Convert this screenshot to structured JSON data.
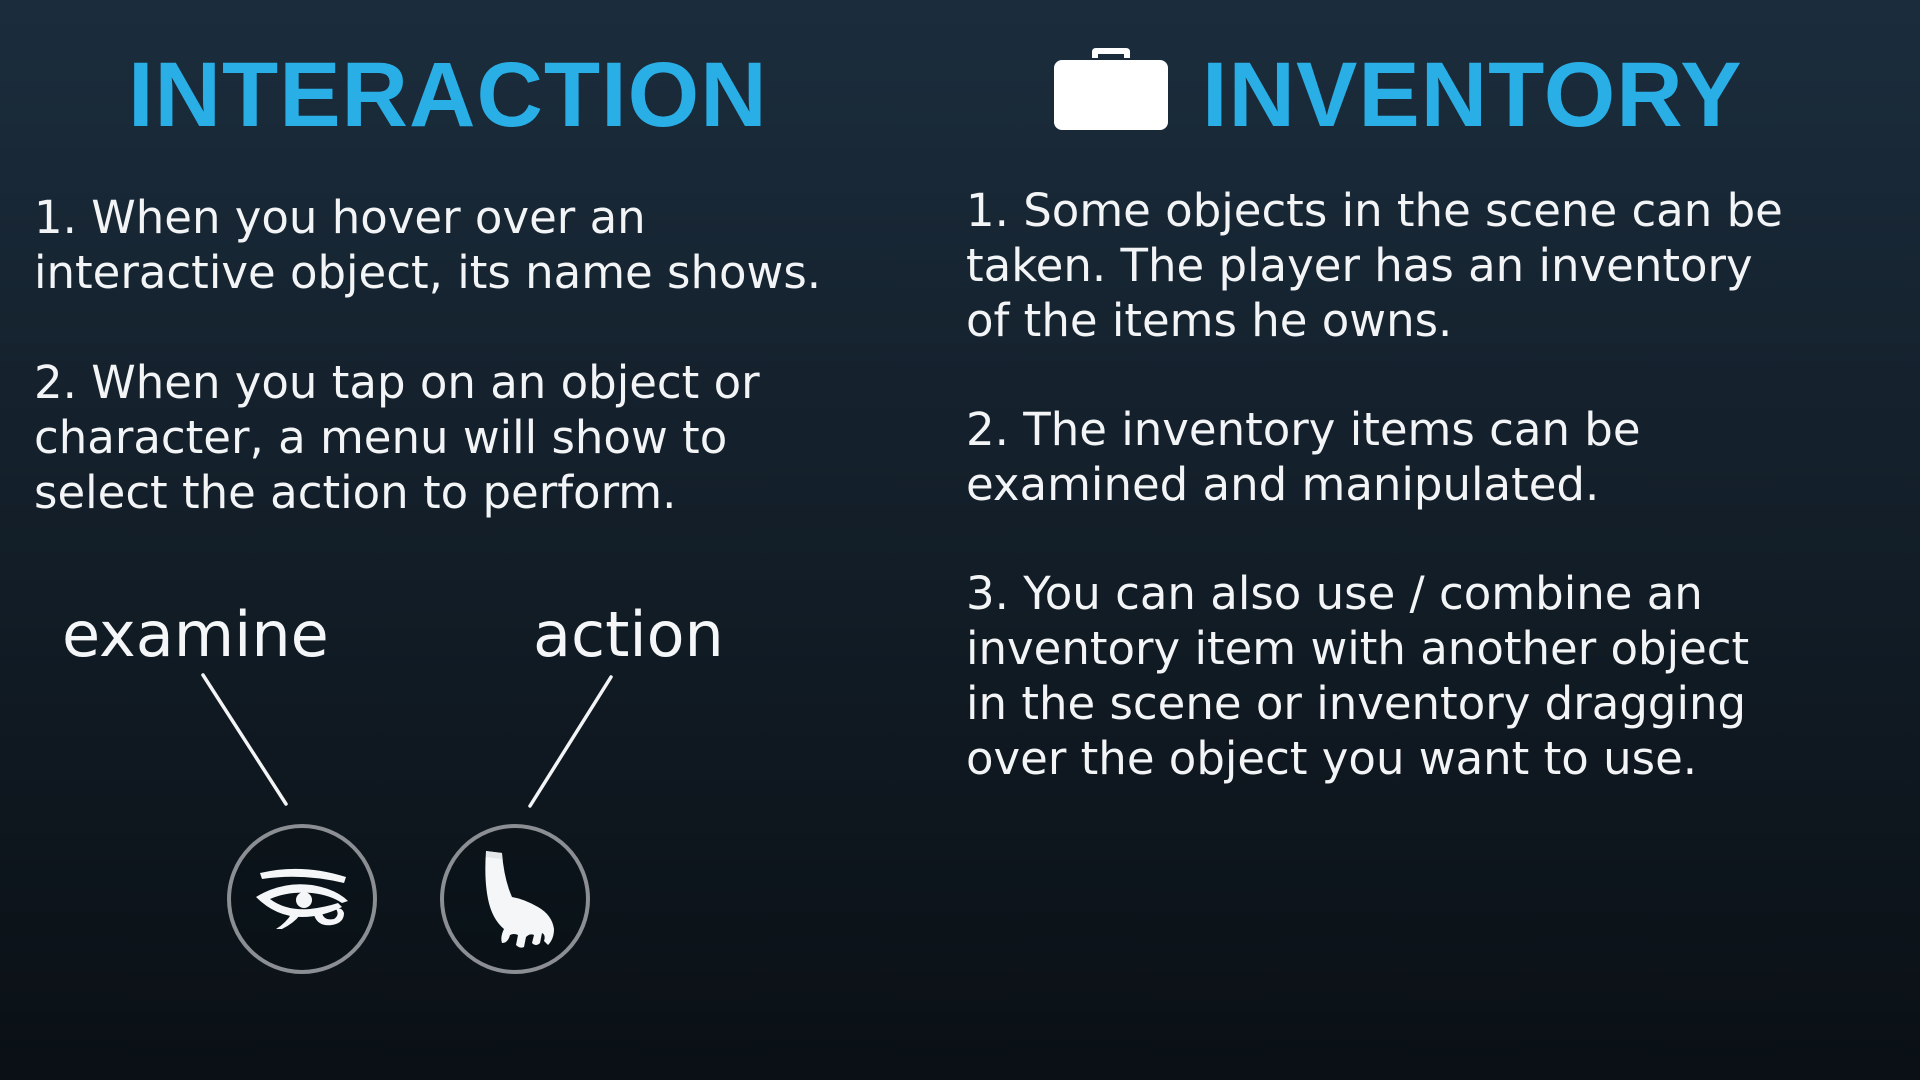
{
  "interaction": {
    "title": "INTERACTION",
    "paragraphs": [
      "1. When you hover over an\ninteractive object, its name shows.",
      "2. When you tap on an object or\ncharacter, a menu will show to\nselect the action to perform."
    ],
    "menu": {
      "examine_label": "examine",
      "action_label": "action",
      "examine_icon": "eye-of-horus-icon",
      "action_icon": "grabbing-hand-icon"
    }
  },
  "inventory": {
    "title": "INVENTORY",
    "title_icon": "briefcase-icon",
    "paragraphs": [
      "1. Some objects in the scene can be\ntaken. The player has an inventory\nof the items he owns.",
      "2. The inventory items can be\nexamined and manipulated.",
      "3. You can also use / combine an\ninventory item with another object\nin the scene or inventory dragging\nover the object you want to use."
    ]
  },
  "colors": {
    "heading": "#29aee6",
    "text": "#f2f4f6",
    "button_ring": "#8b8f93",
    "background_top": "#1b2d3d",
    "background_bottom": "#0a1015"
  }
}
